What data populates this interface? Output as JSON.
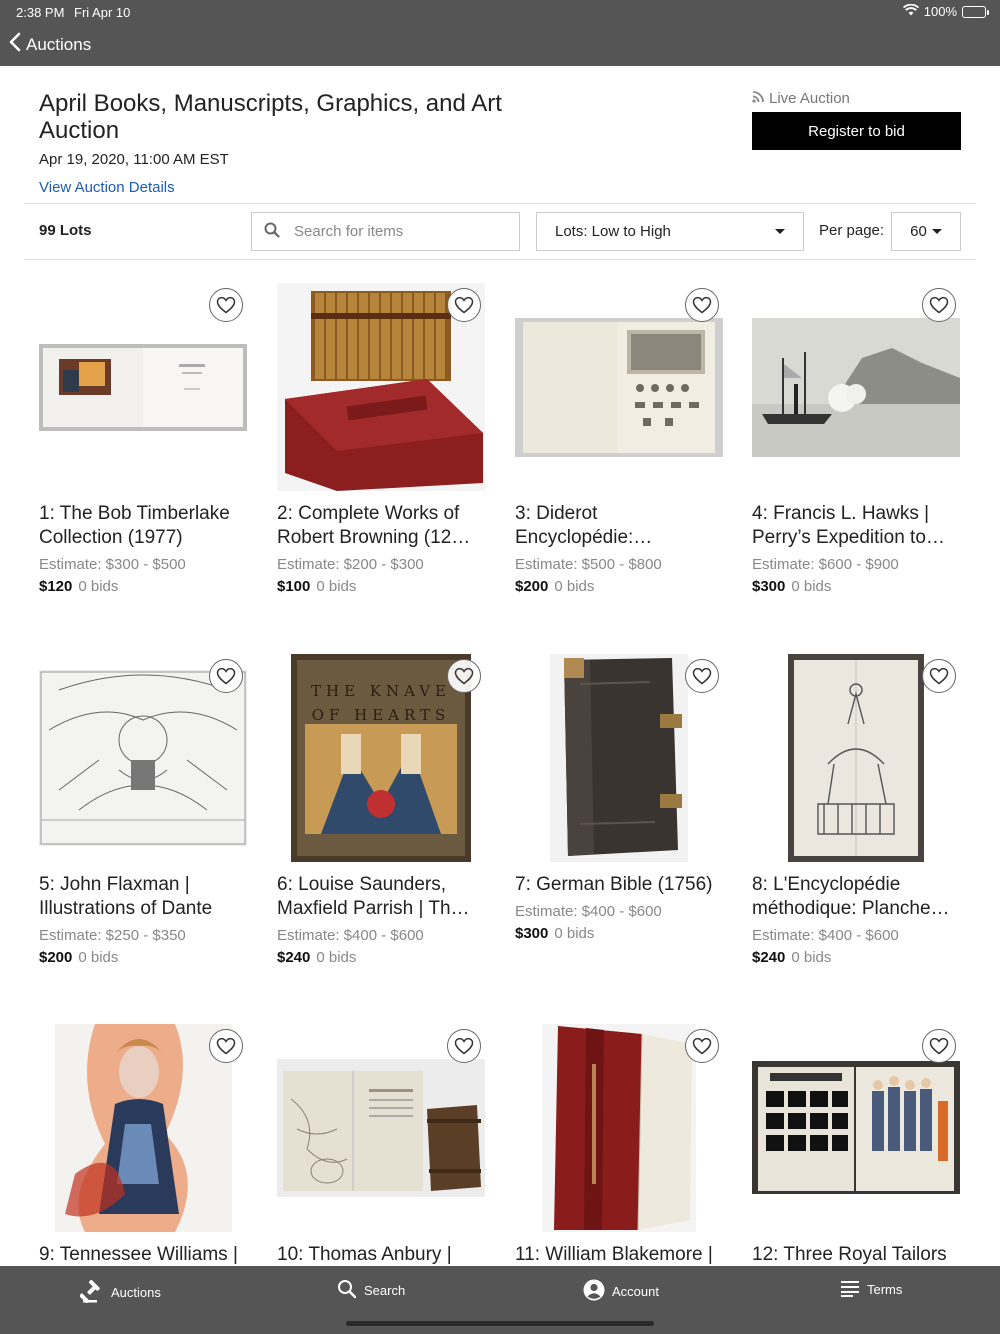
{
  "status": {
    "time": "2:38 PM",
    "date": "Fri Apr 10",
    "battery": "100%"
  },
  "nav": {
    "back_label": "Auctions"
  },
  "auction": {
    "title": "April Books, Manuscripts, Graphics, and Art Auction",
    "date": "Apr 19, 2020, 11:00 AM EST",
    "details_link": "View Auction Details",
    "live_label": "Live Auction",
    "register_label": "Register to bid"
  },
  "filters": {
    "lots_count": "99 Lots",
    "search_placeholder": "Search for items",
    "sort_value": "Lots: Low to High",
    "per_page_label": "Per page:",
    "per_page_value": "60"
  },
  "lots": [
    {
      "title": "1: The Bob Timberlake Collection (1977)",
      "estimate": "Estimate: $300 - $500",
      "price": "$120",
      "bids": "0 bids",
      "image_icon": "open-book-image"
    },
    {
      "title": "2: Complete Works of Robert Browning (12…",
      "estimate": "Estimate: $200 - $300",
      "price": "$100",
      "bids": "0 bids",
      "image_icon": "book-set-image"
    },
    {
      "title": "3: Diderot Encyclopédie:…",
      "estimate": "Estimate: $500 - $800",
      "price": "$200",
      "bids": "0 bids",
      "image_icon": "encyclopedia-plate-image"
    },
    {
      "title": "4: Francis L. Hawks | Perry’s Expedition to…",
      "estimate": "Estimate: $600 - $900",
      "price": "$300",
      "bids": "0 bids",
      "image_icon": "ship-print-image"
    },
    {
      "title": "5: John Flaxman | Illustrations of Dante",
      "estimate": "Estimate: $250 - $350",
      "price": "$200",
      "bids": "0 bids",
      "image_icon": "dante-illustration-image"
    },
    {
      "title": "6: Louise Saunders, Maxfield Parrish | Th…",
      "estimate": "Estimate: $400 - $600",
      "price": "$240",
      "bids": "0 bids",
      "image_icon": "knave-of-hearts-book-image",
      "cover_text_1": "THE KNAVE",
      "cover_text_2": "OF HEARTS"
    },
    {
      "title": "7: German Bible (1756)",
      "estimate": "Estimate: $400 - $600",
      "price": "$300",
      "bids": "0 bids",
      "image_icon": "leather-bible-image"
    },
    {
      "title": "8: L'Encyclopédie méthodique: Planche…",
      "estimate": "Estimate: $400 - $600",
      "price": "$240",
      "bids": "0 bids",
      "image_icon": "equestrian-plate-image"
    },
    {
      "title": "9: Tennessee Williams |",
      "image_icon": "portrait-painting-image"
    },
    {
      "title": "10: Thomas Anbury |",
      "image_icon": "map-book-image"
    },
    {
      "title": "11: William Blakemore |",
      "image_icon": "red-bound-book-image"
    },
    {
      "title": "12: Three Royal Tailors",
      "image_icon": "tailor-catalog-image"
    }
  ],
  "tabbar": {
    "items": [
      {
        "label": "Auctions",
        "icon": "gavel-icon"
      },
      {
        "label": "Search",
        "icon": "search-icon"
      },
      {
        "label": "Account",
        "icon": "account-icon"
      },
      {
        "label": "Terms",
        "icon": "list-icon"
      }
    ]
  },
  "colors": {
    "bar": "#555555",
    "link": "#1a5fb4",
    "button": "#000000"
  }
}
